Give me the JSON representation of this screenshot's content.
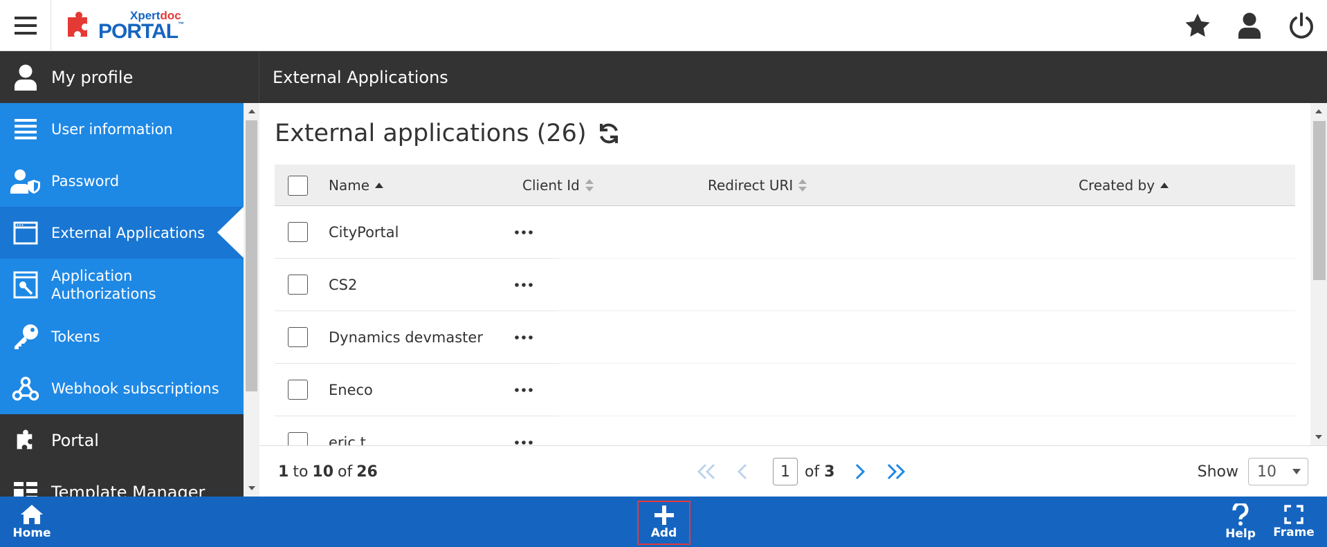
{
  "header": {
    "logo_top_a": "Xpert",
    "logo_top_b": "doc",
    "logo_bottom": "PORTAL",
    "logo_tm": "™",
    "icons": [
      "menu-icon",
      "star-icon",
      "user-icon",
      "power-icon"
    ]
  },
  "band": {
    "left_title": "My profile",
    "right_title": "External Applications"
  },
  "sidebar": {
    "items": [
      {
        "label": "User information",
        "icon": "list-icon"
      },
      {
        "label": "Password",
        "icon": "user-shield-icon"
      },
      {
        "label": "External Applications",
        "icon": "window-icon",
        "active": true
      },
      {
        "label": "Application Authorizations",
        "icon": "app-key-icon"
      },
      {
        "label": "Tokens",
        "icon": "key-icon"
      },
      {
        "label": "Webhook subscriptions",
        "icon": "webhook-icon"
      },
      {
        "label": "Portal",
        "icon": "puzzle-icon"
      },
      {
        "label": "Template Manager",
        "icon": "dashboard-icon"
      }
    ]
  },
  "main": {
    "heading": "External applications (26)",
    "columns": {
      "name": "Name",
      "client_id": "Client Id",
      "redirect_uri": "Redirect URI",
      "created_by": "Created by"
    },
    "rows": [
      {
        "name": "CityPortal"
      },
      {
        "name": "CS2"
      },
      {
        "name": "Dynamics devmaster"
      },
      {
        "name": "Eneco"
      },
      {
        "name": "eric t"
      }
    ]
  },
  "pager": {
    "range_start": "1",
    "range_to": "to",
    "range_end": "10",
    "range_of": "of",
    "total": "26",
    "page": "1",
    "page_of": "of",
    "page_count": "3",
    "show_label": "Show",
    "page_size": "10"
  },
  "bottombar": {
    "home": "Home",
    "add": "Add",
    "help": "Help",
    "frame": "Frame"
  }
}
